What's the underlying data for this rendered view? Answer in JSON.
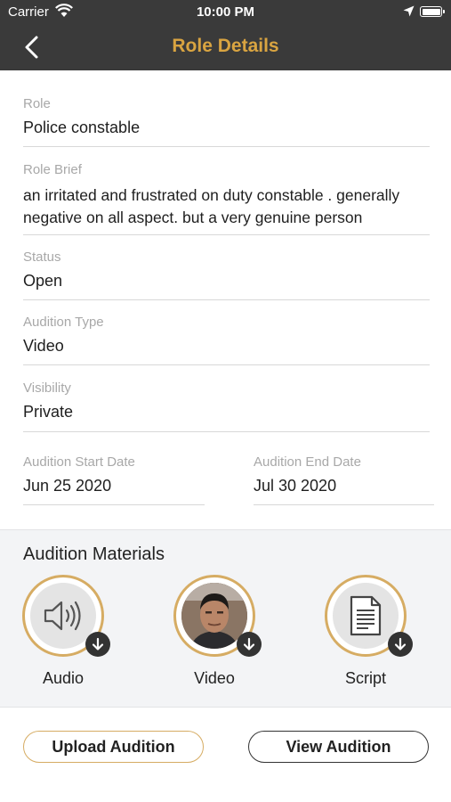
{
  "status_bar": {
    "carrier": "Carrier",
    "time": "10:00 PM"
  },
  "nav": {
    "title": "Role Details"
  },
  "fields": {
    "role": {
      "label": "Role",
      "value": "Police constable"
    },
    "role_brief": {
      "label": "Role Brief",
      "value": "an irritated and frustrated on duty constable . generally negative on all aspect. but a very genuine person"
    },
    "status": {
      "label": "Status",
      "value": "Open"
    },
    "audition_type": {
      "label": "Audition Type",
      "value": "Video"
    },
    "visibility": {
      "label": "Visibility",
      "value": "Private"
    },
    "start_date": {
      "label": "Audition Start Date",
      "value": "Jun 25 2020"
    },
    "end_date": {
      "label": "Audition End Date",
      "value": "Jul 30 2020"
    }
  },
  "materials": {
    "heading": "Audition Materials",
    "items": [
      {
        "label": "Audio",
        "icon": "speaker-icon"
      },
      {
        "label": "Video",
        "icon": "video-thumbnail"
      },
      {
        "label": "Script",
        "icon": "document-icon"
      }
    ]
  },
  "actions": {
    "upload_label": "Upload Audition",
    "view_label": "View Audition"
  },
  "colors": {
    "bar": "#3a3a3a",
    "accent": "#d9a441",
    "ring": "#d6ac63"
  }
}
